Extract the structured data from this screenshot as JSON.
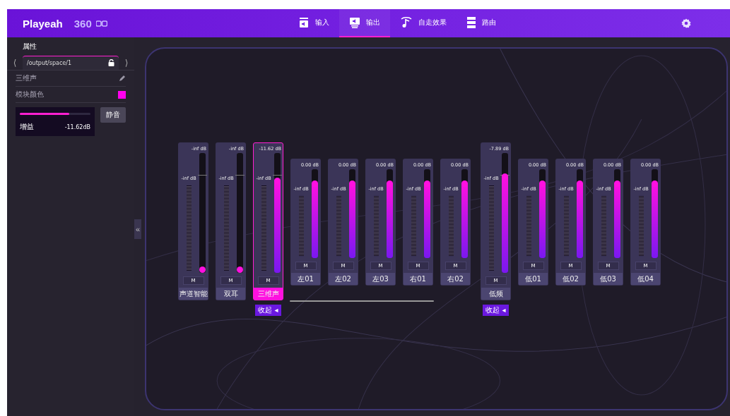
{
  "header": {
    "logo": "Playeah",
    "logo_suffix": "360",
    "tabs": [
      {
        "label": "输入",
        "selected": false
      },
      {
        "label": "输出",
        "selected": true
      },
      {
        "label": "自走效果",
        "selected": false
      },
      {
        "label": "路由",
        "selected": false
      }
    ]
  },
  "sidebar": {
    "title": "属性",
    "prev": "⟨",
    "next": "⟩",
    "collapse_button": "«",
    "path": "/output/space/1",
    "name": "三维声",
    "color_label": "模块颜色",
    "color": "#ff00ee",
    "gain": {
      "level": 0.7,
      "label": "增益",
      "reading": "-11.62dB"
    },
    "mute_button": "静音"
  },
  "strips": [
    {
      "name": "声道智能",
      "kind": "tall",
      "reading": "-inf dB",
      "meter": "-inf dB",
      "level": 0,
      "selected": false,
      "mute": "M"
    },
    {
      "name": "双耳",
      "kind": "tall",
      "reading": "-inf dB",
      "meter": "-inf dB",
      "level": 0,
      "selected": false,
      "mute": "M"
    },
    {
      "name": "三维声",
      "kind": "tall",
      "reading": "-11.62 dB",
      "meter": "-inf dB",
      "level": 0.78,
      "selected": true,
      "mute": "M",
      "collapse": "收起 ◂"
    },
    {
      "name": "左01",
      "kind": "short",
      "reading": "0.00 dB",
      "meter": "-inf dB",
      "level": 0.86,
      "selected": false,
      "mute": "M"
    },
    {
      "name": "左02",
      "kind": "short",
      "reading": "0.00 dB",
      "meter": "-inf dB",
      "level": 0.86,
      "selected": false,
      "mute": "M"
    },
    {
      "name": "左03",
      "kind": "short",
      "reading": "0.00 dB",
      "meter": "-inf dB",
      "level": 0.86,
      "selected": false,
      "mute": "M"
    },
    {
      "name": "右01",
      "kind": "short",
      "reading": "0.00 dB",
      "meter": "-inf dB",
      "level": 0.86,
      "selected": false,
      "mute": "M"
    },
    {
      "name": "右02",
      "kind": "short",
      "reading": "0.00 dB",
      "meter": "-inf dB",
      "level": 0.86,
      "selected": false,
      "mute": "M"
    },
    {
      "name": "低频",
      "kind": "tall",
      "reading": "-7.89 dB",
      "meter": "-inf dB",
      "level": 0.82,
      "selected": false,
      "mute": "M",
      "collapse": "收起 ◂"
    },
    {
      "name": "低01",
      "kind": "short",
      "reading": "0.00 dB",
      "meter": "-inf dB",
      "level": 0.86,
      "selected": false,
      "mute": "M"
    },
    {
      "name": "低02",
      "kind": "short",
      "reading": "0.00 dB",
      "meter": "-inf dB",
      "level": 0.86,
      "selected": false,
      "mute": "M"
    },
    {
      "name": "低03",
      "kind": "short",
      "reading": "0.00 dB",
      "meter": "-inf dB",
      "level": 0.86,
      "selected": false,
      "mute": "M"
    },
    {
      "name": "低04",
      "kind": "short",
      "reading": "0.00 dB",
      "meter": "-inf dB",
      "level": 0.86,
      "selected": false,
      "mute": "M"
    }
  ]
}
